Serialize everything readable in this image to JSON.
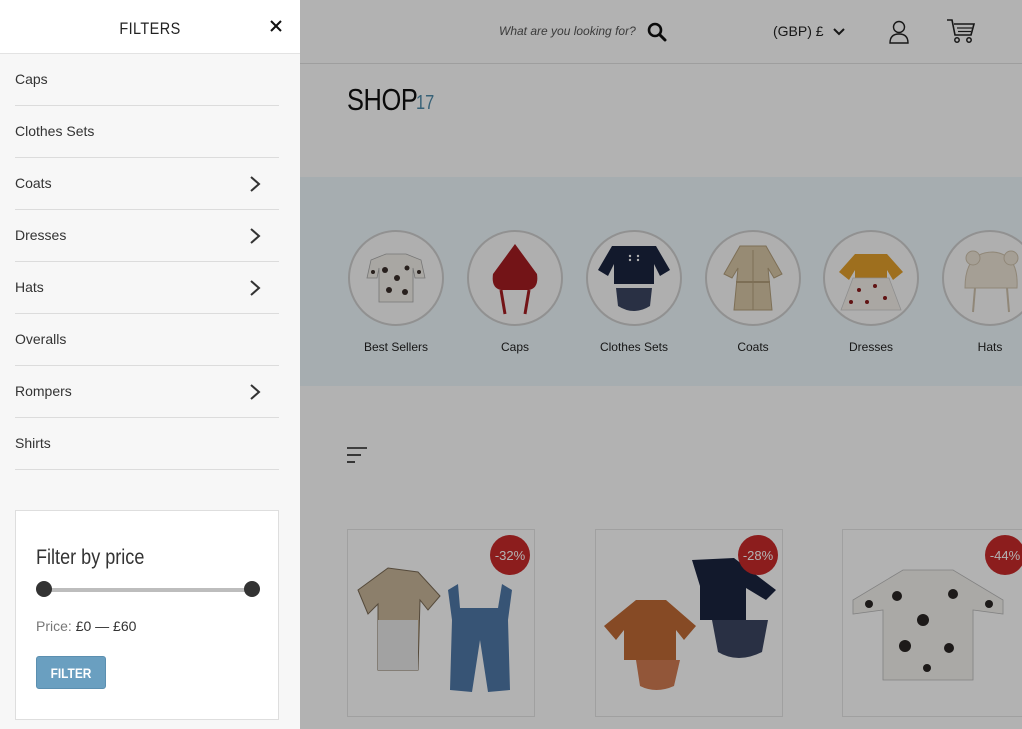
{
  "header": {
    "search_placeholder": "What are you looking for?",
    "currency": "(GBP) £"
  },
  "shop": {
    "title": "SHOP",
    "count": "17"
  },
  "categories": [
    {
      "label": "Best Sellers"
    },
    {
      "label": "Caps"
    },
    {
      "label": "Clothes Sets"
    },
    {
      "label": "Coats"
    },
    {
      "label": "Dresses"
    },
    {
      "label": "Hats"
    }
  ],
  "products": [
    {
      "badge": "-32%"
    },
    {
      "badge": "-28%"
    },
    {
      "badge": "-44%"
    }
  ],
  "drawer": {
    "title": "FILTERS",
    "items": [
      {
        "label": "Caps",
        "has_children": false
      },
      {
        "label": "Clothes Sets",
        "has_children": false
      },
      {
        "label": "Coats",
        "has_children": true
      },
      {
        "label": "Dresses",
        "has_children": true
      },
      {
        "label": "Hats",
        "has_children": true
      },
      {
        "label": "Overalls",
        "has_children": false
      },
      {
        "label": "Rompers",
        "has_children": true
      },
      {
        "label": "Shirts",
        "has_children": false
      }
    ],
    "price_filter": {
      "title": "Filter by price",
      "price_label": "Price:",
      "min": "£0",
      "separator": "—",
      "max": "£60",
      "button_label": "FILTER"
    }
  },
  "colors": {
    "accent": "#4f8cab",
    "filter_button": "#6a9fc0",
    "sale_badge": "#c92a2a",
    "category_band": "#eef8fc"
  }
}
